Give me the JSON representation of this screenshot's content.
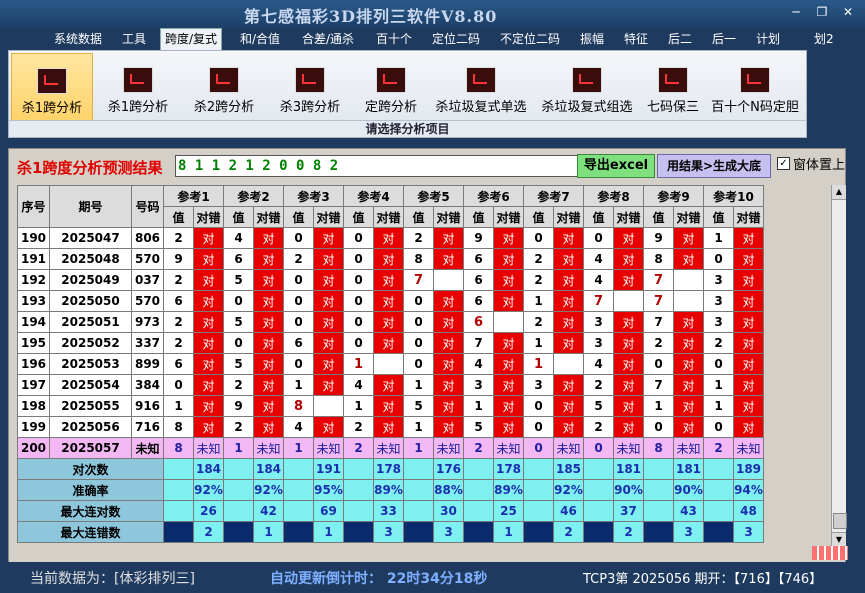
{
  "window": {
    "title": "第七感福彩3D排列三软件V8.80"
  },
  "menu": [
    "系统数据",
    "工具",
    "跨度/复式",
    "和/合值",
    "合差/通杀",
    "百十个",
    "定位二码",
    "不定位二码",
    "振幅",
    "特征",
    "后二",
    "后一",
    "计划",
    "划2"
  ],
  "menu_active": "跨度/复式",
  "ribbon": {
    "buttons": [
      "杀1跨分析",
      "杀1跨分析",
      "杀2跨分析",
      "杀3跨分析",
      "定跨分析",
      "杀垃圾复式单选",
      "杀垃圾复式组选",
      "七码保三",
      "百十个N码定胆"
    ],
    "active_index": 0,
    "caption": "请选择分析项目"
  },
  "panel": {
    "heading": "杀1跨度分析预测结果",
    "result_value": "8 1 1 2 1 2 0 0 8 2",
    "export_label": "导出excel",
    "generate_label": "用结果>生成大底",
    "pin_label": "窗体置上",
    "pin_checked": "✓"
  },
  "table": {
    "col_index": "序号",
    "col_period": "期号",
    "col_number": "号码",
    "refs": [
      "参考1",
      "参考2",
      "参考3",
      "参考4",
      "参考5",
      "参考6",
      "参考7",
      "参考8",
      "参考9",
      "参考10"
    ],
    "sub_value": "值",
    "sub_result": "对错",
    "hit_word": "对",
    "unknown_word": "未知",
    "rows": [
      {
        "idx": "190",
        "period": "2025047",
        "num": "806",
        "vals": [
          "2",
          "4",
          "0",
          "0",
          "2",
          "9",
          "0",
          "0",
          "9",
          "1"
        ],
        "miss": []
      },
      {
        "idx": "191",
        "period": "2025048",
        "num": "570",
        "vals": [
          "9",
          "6",
          "2",
          "0",
          "8",
          "6",
          "2",
          "4",
          "8",
          "0"
        ],
        "miss": []
      },
      {
        "idx": "192",
        "period": "2025049",
        "num": "037",
        "vals": [
          "2",
          "5",
          "0",
          "0",
          "7",
          "6",
          "2",
          "4",
          "7",
          "3"
        ],
        "miss": [
          4,
          8
        ]
      },
      {
        "idx": "193",
        "period": "2025050",
        "num": "570",
        "vals": [
          "6",
          "0",
          "0",
          "0",
          "0",
          "6",
          "1",
          "7",
          "7",
          "3"
        ],
        "miss": [
          7,
          8
        ]
      },
      {
        "idx": "194",
        "period": "2025051",
        "num": "973",
        "vals": [
          "2",
          "5",
          "0",
          "0",
          "0",
          "6",
          "2",
          "3",
          "7",
          "3"
        ],
        "miss": [
          5
        ]
      },
      {
        "idx": "195",
        "period": "2025052",
        "num": "337",
        "vals": [
          "2",
          "0",
          "6",
          "0",
          "0",
          "7",
          "1",
          "3",
          "2",
          "2"
        ],
        "miss": []
      },
      {
        "idx": "196",
        "period": "2025053",
        "num": "899",
        "vals": [
          "6",
          "5",
          "0",
          "1",
          "0",
          "4",
          "1",
          "4",
          "0",
          "0"
        ],
        "miss": [
          3,
          6
        ]
      },
      {
        "idx": "197",
        "period": "2025054",
        "num": "384",
        "vals": [
          "0",
          "2",
          "1",
          "4",
          "1",
          "3",
          "3",
          "2",
          "7",
          "1"
        ],
        "miss": []
      },
      {
        "idx": "198",
        "period": "2025055",
        "num": "916",
        "vals": [
          "1",
          "9",
          "8",
          "1",
          "5",
          "1",
          "0",
          "5",
          "1",
          "1"
        ],
        "miss": [
          2
        ]
      },
      {
        "idx": "199",
        "period": "2025056",
        "num": "716",
        "vals": [
          "8",
          "2",
          "4",
          "2",
          "1",
          "5",
          "0",
          "2",
          "0",
          "0"
        ],
        "miss": []
      }
    ],
    "unknown_row": {
      "idx": "200",
      "period": "2025057",
      "num": "未知",
      "vals": [
        "8",
        "1",
        "1",
        "2",
        "1",
        "2",
        "0",
        "0",
        "8",
        "2"
      ]
    },
    "stats": [
      {
        "label": "对次数",
        "values": [
          "184",
          "184",
          "191",
          "178",
          "176",
          "178",
          "185",
          "181",
          "181",
          "189"
        ]
      },
      {
        "label": "准确率",
        "values": [
          "92%",
          "92%",
          "95%",
          "89%",
          "88%",
          "89%",
          "92%",
          "90%",
          "90%",
          "94%"
        ]
      },
      {
        "label": "最大连对数",
        "values": [
          "26",
          "42",
          "69",
          "33",
          "30",
          "25",
          "46",
          "37",
          "43",
          "48"
        ]
      },
      {
        "label": "最大连错数",
        "values": [
          "2",
          "1",
          "1",
          "3",
          "3",
          "1",
          "2",
          "2",
          "3",
          "3"
        ]
      }
    ]
  },
  "statusbar": {
    "data_label": "当前数据为：[体彩排列三]",
    "timer": "自动更新倒计时：  22时34分18秒",
    "tcp": "TCP3第 2025056 期开：【716】【746】"
  }
}
